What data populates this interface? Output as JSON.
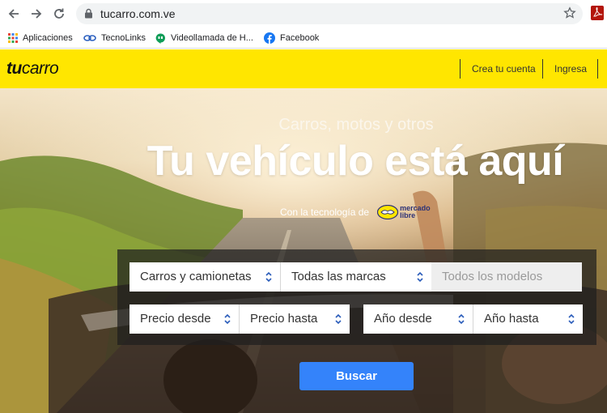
{
  "browser": {
    "url": "tucarro.com.ve",
    "bookmarks": [
      {
        "label": "Aplicaciones",
        "icon": "apps-grid-icon"
      },
      {
        "label": "TecnoLinks",
        "icon": "link-icon"
      },
      {
        "label": "Videollamada de H...",
        "icon": "hangouts-icon"
      },
      {
        "label": "Facebook",
        "icon": "facebook-icon"
      }
    ]
  },
  "header": {
    "logo_light": "tu",
    "logo_bold": "carro",
    "create_account": "Crea tu cuenta",
    "login": "Ingresa",
    "background_color": "#ffe600"
  },
  "hero": {
    "subtitle": "Carros, motos y otros",
    "title": "Tu vehículo está aquí",
    "powered_by": "Con la tecnología de",
    "partner_line1": "mercado",
    "partner_line2": "libre"
  },
  "search": {
    "category": "Carros y camionetas",
    "brand": "Todas las marcas",
    "model": "Todos los modelos",
    "price_from": "Precio desde",
    "price_to": "Precio hasta",
    "year_from": "Año desde",
    "year_to": "Año hasta",
    "submit": "Buscar",
    "accent_color": "#3483fa"
  }
}
